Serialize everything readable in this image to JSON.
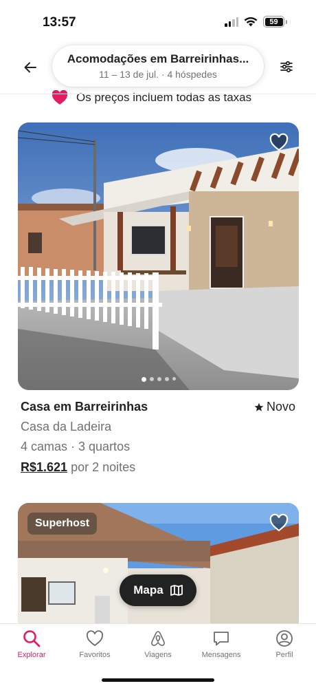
{
  "status": {
    "time": "13:57",
    "battery": "59"
  },
  "header": {
    "title": "Acomodações em Barreirinhas...",
    "subtitle": "11 – 13 de jul. · 4 hóspedes"
  },
  "notice": {
    "text": "Os preços incluem todas as taxas",
    "icon": "heart-tag-icon",
    "color": "#E31C5F"
  },
  "listings": [
    {
      "title": "Casa em Barreirinhas",
      "rating_label": "Novo",
      "name": "Casa da Ladeira",
      "details": "4 camas · 3 quartos",
      "price": "R$1.621",
      "price_suffix": "por 2 noites",
      "photo_count": 5,
      "active_photo": 0
    },
    {
      "badge": "Superhost"
    }
  ],
  "map_button": {
    "label": "Mapa"
  },
  "tabs": [
    {
      "label": "Explorar",
      "icon": "search-icon",
      "active": true
    },
    {
      "label": "Favoritos",
      "icon": "heart-icon",
      "active": false
    },
    {
      "label": "Viagens",
      "icon": "airbnb-logo-icon",
      "active": false
    },
    {
      "label": "Mensagens",
      "icon": "message-icon",
      "active": false
    },
    {
      "label": "Perfil",
      "icon": "profile-icon",
      "active": false
    }
  ],
  "colors": {
    "accent": "#E31C5F",
    "text": "#222222",
    "muted": "#717171"
  }
}
